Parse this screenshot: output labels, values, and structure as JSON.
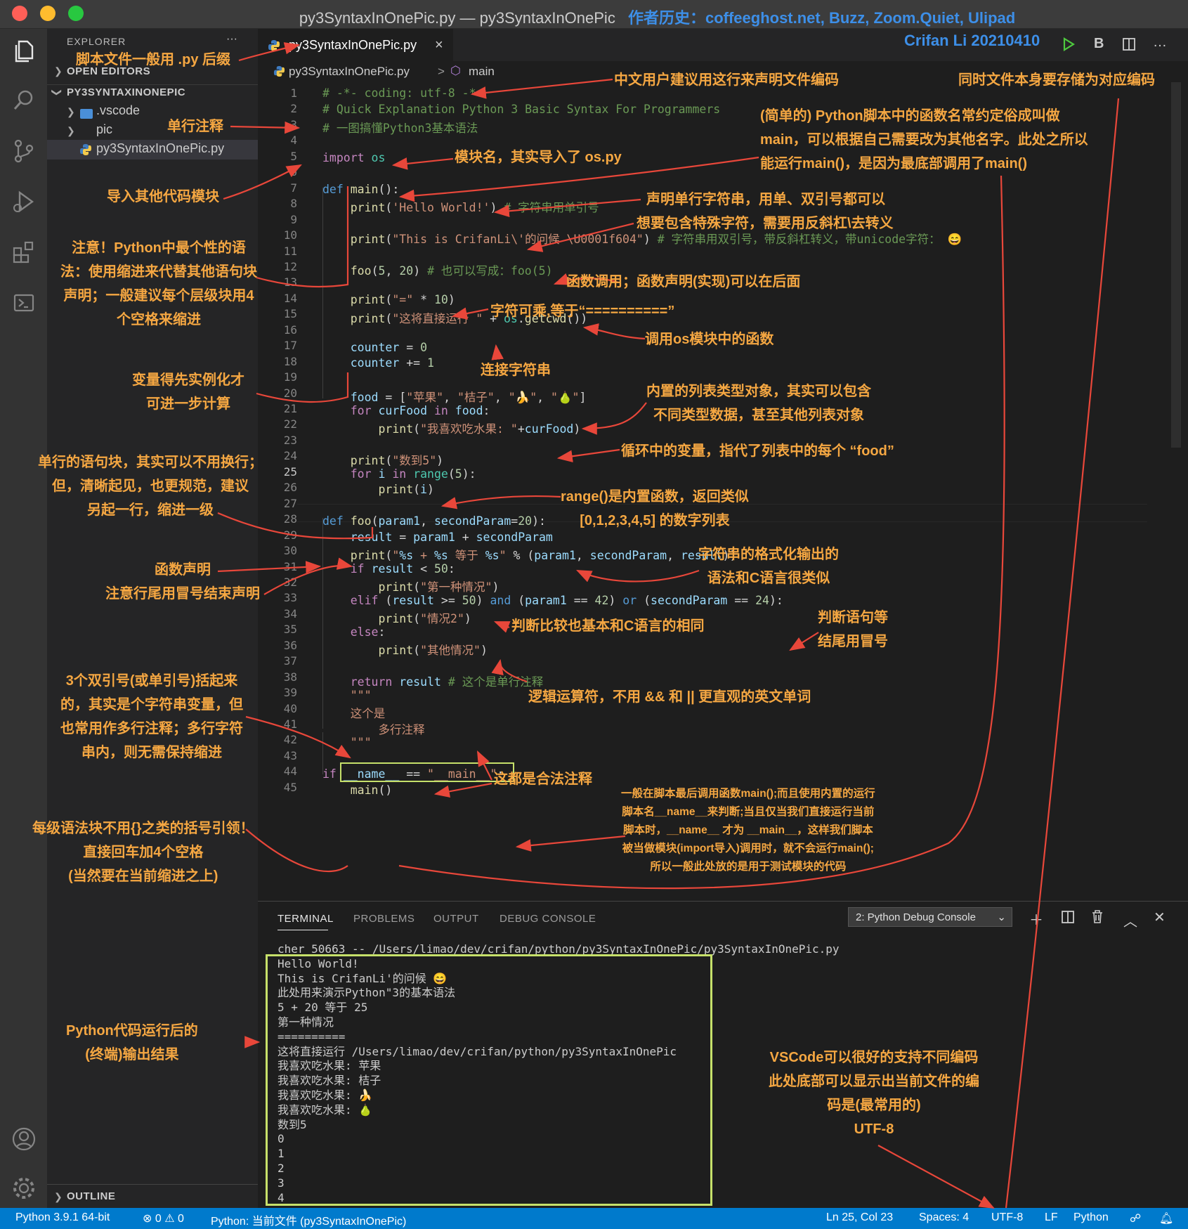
{
  "window": {
    "title": "py3SyntaxInOnePic.py — py3SyntaxInOnePic",
    "history": "作者历史：coffeeghost.net, Buzz, Zoom.Quiet, Ulipad",
    "author": "Crifan Li 20210410"
  },
  "title_actions": {
    "bold": "B",
    "more": "…"
  },
  "sidebar": {
    "title": "EXPLORER",
    "more": "···",
    "open_editors": "OPEN EDITORS",
    "project": "PY3SYNTAXINONEPIC",
    "items": [
      {
        "label": ".vscode"
      },
      {
        "label": "pic"
      },
      {
        "label": "py3SyntaxInOnePic.py"
      }
    ],
    "outline": "OUTLINE"
  },
  "tab": {
    "label": "py3SyntaxInOnePic.py",
    "close": "×"
  },
  "breadcrumb": {
    "file": "py3SyntaxInOnePic.py",
    "sep": ">",
    "symbol": "main"
  },
  "editor": {
    "line_numbers": [
      "1",
      "2",
      "3",
      "4",
      "5",
      "6",
      "7",
      "8",
      "9",
      "10",
      "11",
      "12",
      "13",
      "14",
      "15",
      "16",
      "17",
      "18",
      "19",
      "20",
      "21",
      "22",
      "23",
      "24",
      "25",
      "26",
      "27",
      "28",
      "29",
      "30",
      "31",
      "32",
      "33",
      "34",
      "35",
      "36",
      "37",
      "38",
      "39",
      "40",
      "41",
      "42",
      "43",
      "44",
      "45"
    ],
    "current_line": "25"
  },
  "panel": {
    "tabs": [
      "TERMINAL",
      "PROBLEMS",
      "OUTPUT",
      "DEBUG CONSOLE"
    ],
    "terminal_select": "2: Python Debug Console",
    "terminal_lines": [
      "cher 50663 -- /Users/limao/dev/crifan/python/py3SyntaxInOnePic/py3SyntaxInOnePic.py",
      "Hello World!",
      "This is CrifanLi'的问候 😄",
      "此处用来演示Python\"3的基本语法",
      "5 + 20 等于 25",
      "第一种情况",
      "==========",
      "这将直接运行 /Users/limao/dev/crifan/python/py3SyntaxInOnePic",
      "我喜欢吃水果: 苹果",
      "我喜欢吃水果: 桔子",
      "我喜欢吃水果: 🍌",
      "我喜欢吃水果: 🍐",
      "数到5",
      "0",
      "1",
      "2",
      "3",
      "4"
    ]
  },
  "status": {
    "python": "Python 3.9.1 64-bit",
    "problems": "⊗ 0 ⚠ 0",
    "run": "Python: 当前文件 (py3SyntaxInOnePic)",
    "position": "Ln 25, Col 23",
    "spaces": "Spaces: 4",
    "encoding": "UTF-8",
    "eol": "LF",
    "language": "Python"
  },
  "annotations": {
    "a_suffix": "脚本文件一般用 .py 后缀",
    "a_single_comment": "单行注释",
    "a_import": "导入其他代码模块",
    "a_indent": [
      "注意！Python中最个性的语",
      "法：使用缩进来代替其他语句块",
      "声明；一般建议每个层级块用4",
      "个空格来缩进"
    ],
    "a_var": [
      "变量得先实例化才",
      "可进一步计算"
    ],
    "a_oneline": [
      "单行的语句块，其实可以不用换行；",
      "但，清晰起见，也更规范，建议",
      "另起一行，缩进一级"
    ],
    "a_funcdecl": [
      "函数声明",
      "注意行尾用冒号结束声明"
    ],
    "a_triple": [
      "3个双引号(或单引号)括起来",
      "的，其实是个字符串变量，但",
      "也常用作多行注释；多行字符",
      "串内，则无需保持缩进"
    ],
    "a_enter": [
      "每级语法块不用{}之类的括号引领！",
      "直接回车加4个空格",
      "(当然要在当前缩进之上)"
    ],
    "a_output": [
      "Python代码运行后的",
      "(终端)输出结果"
    ],
    "a_encoding_decl": "中文用户建议用这行来声明文件编码",
    "a_file_encoding": "同时文件本身要存储为对应编码",
    "a_main": [
      "(简单的) Python脚本中的函数名常约定俗成叫做",
      "main，可以根据自己需要改为其他名字。此处之所以",
      "能运行main()，是因为最底部调用了main()"
    ],
    "a_module": "模块名，其实导入了 os.py",
    "a_string": "声明单行字符串，用单、双引号都可以",
    "a_escape": "想要包含特殊字符，需要用反斜杠\\去转义",
    "a_call": "函数调用；函数声明(实现)可以在后面",
    "a_mult": "字符可乘,等于“==========”",
    "a_osfunc": "调用os模块中的函数",
    "a_concat": "连接字符串",
    "a_list": [
      "内置的列表类型对象，其实可以包含",
      "不同类型数据，甚至其他列表对象"
    ],
    "a_loopvar": "循环中的变量，指代了列表中的每个 “food”",
    "a_range": [
      "range()是内置函数，返回类似",
      "[0,1,2,3,4,5] 的数字列表"
    ],
    "a_format": [
      "字符串的格式化输出的",
      "语法和C语言很类似"
    ],
    "a_compare": "判断比较也基本和C语言的相同",
    "a_colon": [
      "判断语句等",
      "结尾用冒号"
    ],
    "a_logic": "逻辑运算符，不用 && 和 || 更直观的英文单词",
    "a_legal": "这都是合法注释",
    "a_name_main": [
      "一般在脚本最后调用函数main();而且使用内置的运行",
      "脚本名__name__来判断;当且仅当我们直接运行当前",
      "脚本时，__name__ 才为 __main__，这样我们脚本",
      "被当做模块(import导入)调用时，就不会运行main();",
      "所以一般此处放的是用于测试模块的代码"
    ],
    "a_vscode": [
      "VSCode可以很好的支持不同编码",
      "此处底部可以显示出当前文件的编",
      "码是(最常用的)",
      "UTF-8"
    ]
  },
  "colors": {
    "annotation": "#f5a742",
    "arrow": "#e8473a",
    "highlight": "#c6e06a",
    "statusbar": "#007acc"
  }
}
